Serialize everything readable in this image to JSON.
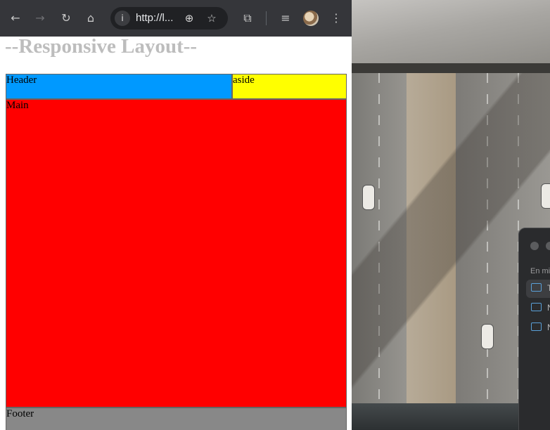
{
  "browser": {
    "toolbar": {
      "back_icon": "←",
      "forward_icon": "→",
      "reload_icon": "↻",
      "home_icon": "⌂",
      "info_icon": "i",
      "url": "http://l...",
      "zoom_icon": "⊕",
      "star_icon": "☆",
      "extensions_icon": "⧉",
      "media_icon": "≡",
      "menu_icon": "⋮"
    },
    "page": {
      "title": "--Responsive Layout--",
      "header_label": "Header",
      "aside_label": "aside",
      "main_label": "Main",
      "footer_label": "Footer",
      "colors": {
        "header": "#0099ff",
        "aside": "#ffff00",
        "main": "#ff0000",
        "footer": "#888888",
        "title": "#bdbdbd"
      }
    }
  },
  "finder": {
    "section_label": "En mi",
    "items": [
      {
        "label": "T"
      },
      {
        "label": "N"
      },
      {
        "label": "N"
      }
    ]
  }
}
